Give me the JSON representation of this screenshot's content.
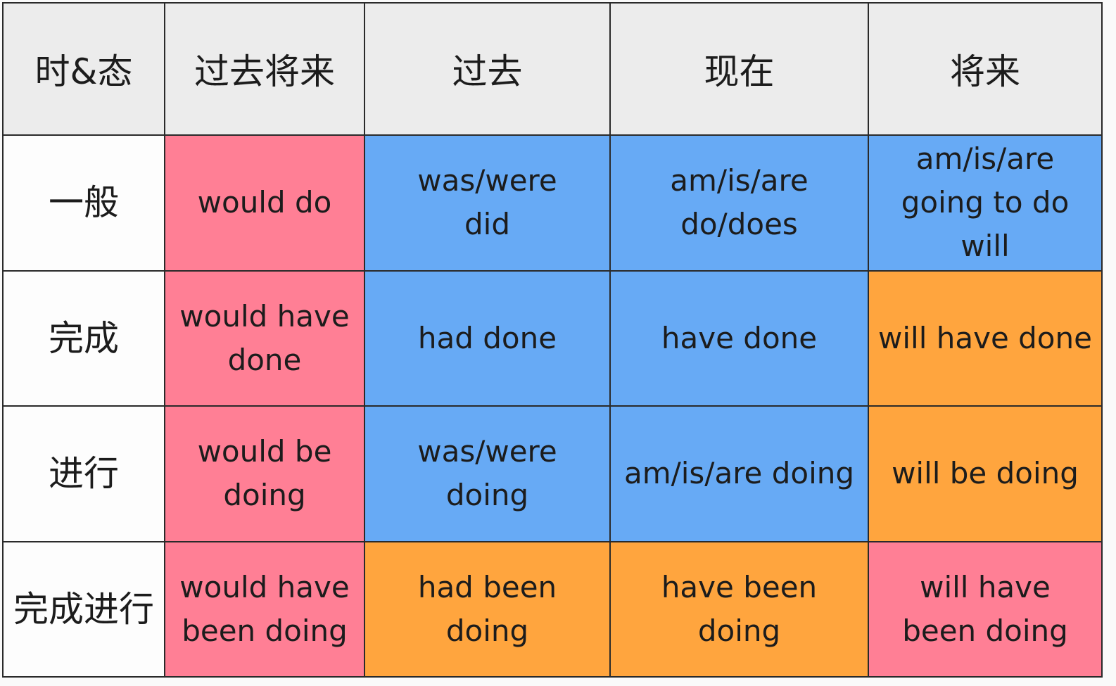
{
  "colors": {
    "pink": "#ff7f95",
    "blue": "#67aaf5",
    "orange": "#ffa53e",
    "header": "#ececec"
  },
  "header": {
    "corner": "时&态",
    "cols": [
      "过去将来",
      "过去",
      "现在",
      "将来"
    ]
  },
  "rows": [
    {
      "label": "一般",
      "cells": [
        {
          "color": "pink",
          "lines": [
            "would do"
          ]
        },
        {
          "color": "blue",
          "lines": [
            "was/were",
            "did"
          ]
        },
        {
          "color": "blue",
          "lines": [
            "am/is/are",
            "do/does"
          ]
        },
        {
          "color": "blue",
          "lines": [
            "am/is/are",
            "going to do",
            "will"
          ]
        }
      ]
    },
    {
      "label": "完成",
      "cells": [
        {
          "color": "pink",
          "lines": [
            "would have",
            "done"
          ]
        },
        {
          "color": "blue",
          "lines": [
            "had done"
          ]
        },
        {
          "color": "blue",
          "lines": [
            "have done"
          ]
        },
        {
          "color": "orange",
          "lines": [
            "will have done"
          ]
        }
      ]
    },
    {
      "label": "进行",
      "cells": [
        {
          "color": "pink",
          "lines": [
            "would be",
            "doing"
          ]
        },
        {
          "color": "blue",
          "lines": [
            "was/were",
            "doing"
          ]
        },
        {
          "color": "blue",
          "lines": [
            "am/is/are doing"
          ]
        },
        {
          "color": "orange",
          "lines": [
            "will be doing"
          ]
        }
      ]
    },
    {
      "label": "完成进行",
      "cells": [
        {
          "color": "pink",
          "lines": [
            "would have",
            "been doing"
          ]
        },
        {
          "color": "orange",
          "lines": [
            "had been",
            "doing"
          ]
        },
        {
          "color": "orange",
          "lines": [
            "have been",
            "doing"
          ]
        },
        {
          "color": "pink",
          "lines": [
            "will have",
            "been doing"
          ]
        }
      ]
    }
  ]
}
